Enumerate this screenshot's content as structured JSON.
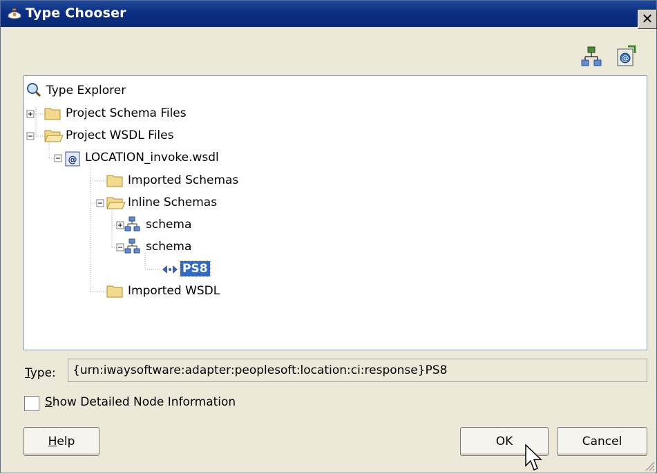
{
  "window": {
    "title": "Type Chooser",
    "close_glyph": "✕",
    "icon": "type-chooser-icon"
  },
  "toolbar": {
    "buttons": [
      {
        "icon": "import-schema-icon"
      },
      {
        "icon": "import-wsdl-icon"
      }
    ]
  },
  "tree": {
    "root": "Type Explorer",
    "items": [
      {
        "label": "Project Schema Files",
        "icon": "folder-closed-icon",
        "expander": "+"
      },
      {
        "label": "Project WSDL Files",
        "icon": "folder-open-icon",
        "expander": "-"
      },
      {
        "label": "LOCATION_invoke.wsdl",
        "icon": "wsdl-file-icon",
        "expander": "-"
      },
      {
        "label": "Imported Schemas",
        "icon": "folder-closed-icon"
      },
      {
        "label": "Inline Schemas",
        "icon": "folder-open-icon",
        "expander": "-"
      },
      {
        "label": "schema",
        "icon": "schema-icon",
        "expander": "+"
      },
      {
        "label": "schema",
        "icon": "schema-icon",
        "expander": "-"
      },
      {
        "label": "PS8",
        "icon": "element-icon",
        "selected": true
      },
      {
        "label": "Imported WSDL",
        "icon": "folder-closed-icon"
      }
    ]
  },
  "type_field": {
    "label_mnemonic": "T",
    "label_rest": "ype:",
    "value": "{urn:iwaysoftware:adapter:peoplesoft:location:ci:response}PS8"
  },
  "show_details": {
    "mnemonic": "S",
    "label_rest": "how Detailed Node Information",
    "checked": false
  },
  "buttons": {
    "help_mnemonic": "H",
    "help_rest": "elp",
    "ok": "OK",
    "cancel": "Cancel"
  },
  "colors": {
    "title_bar": "#0b2e82",
    "selection": "#316ac5",
    "dialog_bg": "#ece9d8"
  }
}
